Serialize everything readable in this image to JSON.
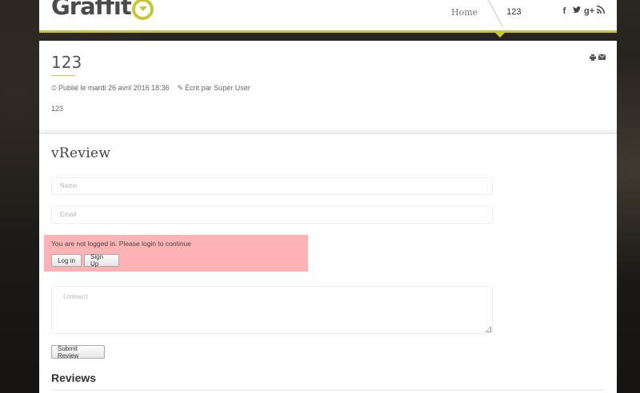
{
  "header": {
    "logo_text": "Graffit",
    "nav": {
      "home": "Home",
      "active": "123"
    },
    "social": [
      {
        "name": "facebook-icon",
        "glyph": "f"
      },
      {
        "name": "twitter-icon",
        "glyph": "✦"
      },
      {
        "name": "google-plus-icon",
        "glyph": "g+"
      },
      {
        "name": "rss-icon",
        "glyph": "◣"
      }
    ],
    "accent_color": "#c6c63a"
  },
  "article": {
    "title": "123",
    "published": "Publié le mardi 26 avril 2016 18:36",
    "author": "Écrit par Super User",
    "body": "123",
    "icons": [
      "print-icon",
      "email-icon"
    ]
  },
  "review": {
    "title": "vReview",
    "name_placeholder": "Name",
    "email_placeholder": "Email",
    "alert_text": "You are not logged in. Please login to continue",
    "login_label": "Log in",
    "signup_label": "Sign Up",
    "comment_placeholder": "Comment",
    "submit_label": "Submit Review",
    "reviews_heading": "Reviews",
    "alert_color": "#ffb3b4"
  }
}
